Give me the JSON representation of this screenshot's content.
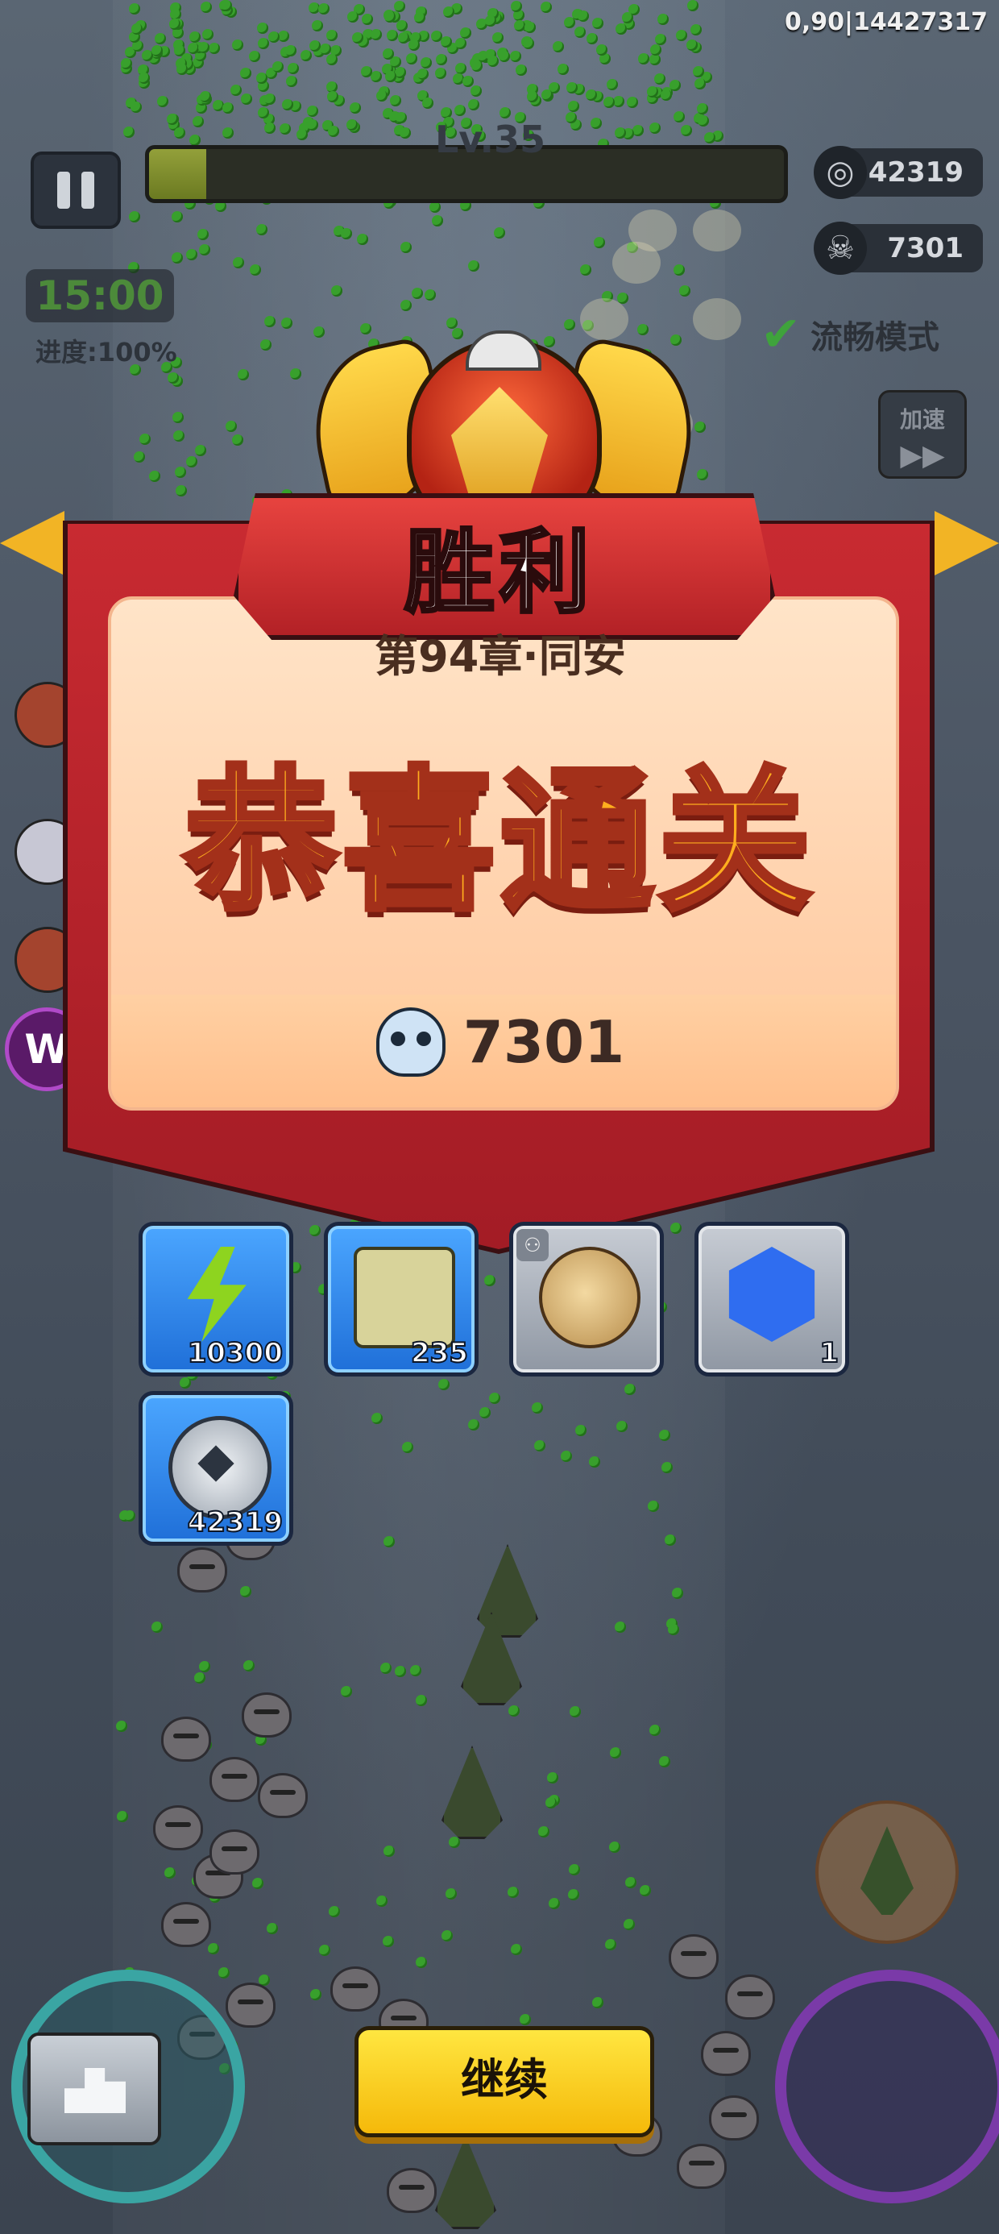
{
  "hud": {
    "coords": "0,90|14427317",
    "level": "Lv.35",
    "xp_fraction": 0.09,
    "coins": "42319",
    "kills": "7301",
    "timer": "15:00",
    "progress": "进度:100%",
    "smooth_mode": "流畅模式",
    "speed_label": "加速",
    "speed_arrows": "▶▶"
  },
  "victory": {
    "title": "胜利",
    "chapter": "第94章·同安",
    "congrats": "恭喜通关",
    "score": "7301"
  },
  "rewards": [
    {
      "icon": "lightning-icon",
      "count": "10300",
      "style": "blue"
    },
    {
      "icon": "map-scroll-icon",
      "count": "235",
      "style": "blue"
    },
    {
      "icon": "amulet-icon",
      "count": "",
      "style": "grey"
    },
    {
      "icon": "blue-crystal-icon",
      "count": "1",
      "style": "grey"
    },
    {
      "icon": "silver-coin-icon",
      "count": "42319",
      "style": "blue"
    }
  ],
  "buttons": {
    "continue": "继续",
    "badge_letter": "W"
  },
  "colors": {
    "banner_red": "#c82a31",
    "continue_yellow": "#ffe640",
    "congrats_orange": "#ffae1e",
    "reward_blue": "#1f6fd8"
  }
}
